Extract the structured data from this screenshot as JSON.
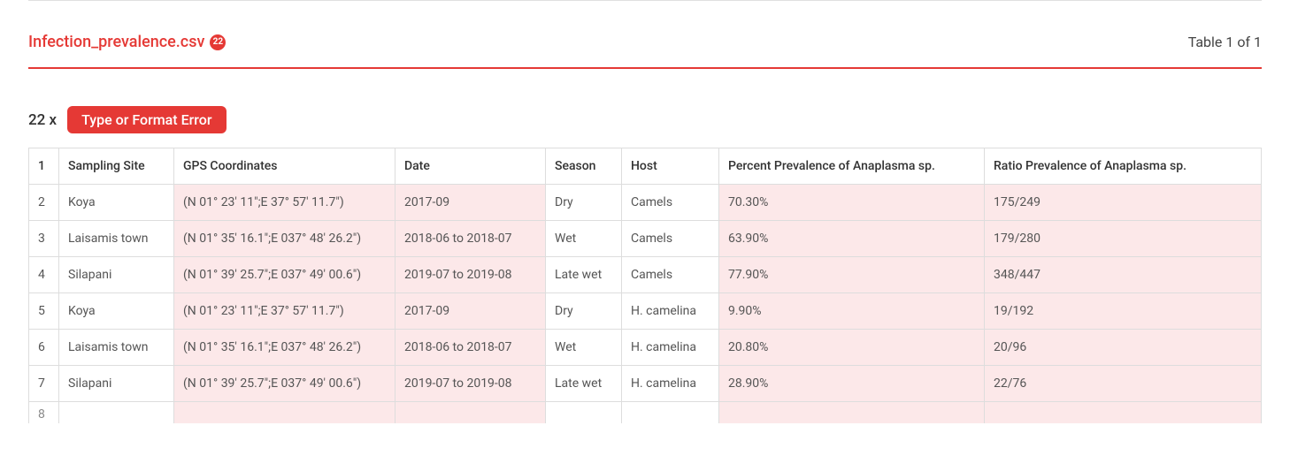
{
  "header": {
    "filename": "Infection_prevalence.csv",
    "badge": "22",
    "table_indicator": "Table 1 of 1"
  },
  "error_summary": {
    "count_text": "22 x",
    "label": "Type or Format Error"
  },
  "columns": {
    "num": "1",
    "site": "Sampling Site",
    "gps": "GPS Coordinates",
    "date": "Date",
    "season": "Season",
    "host": "Host",
    "pp": "Percent Prevalence of Anaplasma sp.",
    "rp": "Ratio Prevalence of Anaplasma sp."
  },
  "rows": [
    {
      "num": "2",
      "site": "Koya",
      "gps": "(N 01° 23' 11\";E 37° 57' 11.7\")",
      "date": "2017-09",
      "season": "Dry",
      "host": "Camels",
      "pp": "70.30%",
      "rp": "175/249"
    },
    {
      "num": "3",
      "site": "Laisamis town",
      "gps": "(N 01° 35' 16.1\";E 037° 48' 26.2\")",
      "date": "2018-06 to 2018-07",
      "season": "Wet",
      "host": "Camels",
      "pp": "63.90%",
      "rp": "179/280"
    },
    {
      "num": "4",
      "site": "Silapani",
      "gps": "(N 01° 39' 25.7\";E 037° 49' 00.6\")",
      "date": "2019-07 to 2019-08",
      "season": "Late wet",
      "host": "Camels",
      "pp": "77.90%",
      "rp": "348/447"
    },
    {
      "num": "5",
      "site": "Koya",
      "gps": "(N 01° 23' 11\";E 37° 57' 11.7\")",
      "date": "2017-09",
      "season": "Dry",
      "host": "H. camelina",
      "pp": "9.90%",
      "rp": "19/192"
    },
    {
      "num": "6",
      "site": "Laisamis town",
      "gps": "(N 01° 35' 16.1\";E 037° 48' 26.2\")",
      "date": "2018-06 to 2018-07",
      "season": "Wet",
      "host": "H. camelina",
      "pp": "20.80%",
      "rp": "20/96"
    },
    {
      "num": "7",
      "site": "Silapani",
      "gps": "(N 01° 39' 25.7\";E 037° 49' 00.6\")",
      "date": "2019-07 to 2019-08",
      "season": "Late wet",
      "host": "H. camelina",
      "pp": "28.90%",
      "rp": "22/76"
    }
  ],
  "truncated_row_num": "8"
}
